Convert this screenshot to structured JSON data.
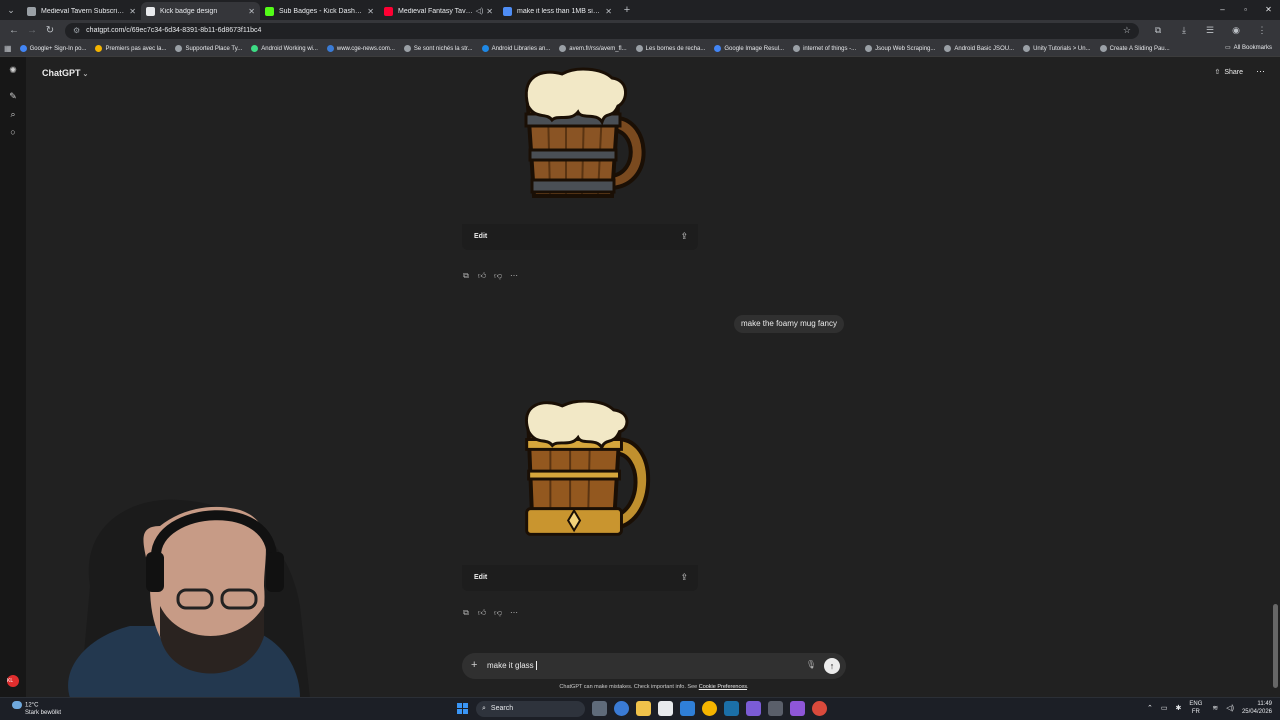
{
  "browser": {
    "tabs": [
      {
        "title": "Medieval Tavern Subscriber Ba...",
        "fav": "#9aa0a6",
        "active": false
      },
      {
        "title": "Kick badge design",
        "fav": "#e8eaed",
        "active": true
      },
      {
        "title": "Sub Badges - Kick Dashboard",
        "fav": "#53fc18",
        "active": false
      },
      {
        "title": "Medieval Fantasy Tavern 3",
        "fav": "#ff0033",
        "active": false
      },
      {
        "title": "make it less than 1MB size - Go...",
        "fav": "#4e8df5",
        "active": false
      }
    ],
    "url": "chatgpt.com/c/69ec7c34-6d34-8391-8b11-6d8673f11bc4",
    "bookmarks": [
      "Google+ Sign-In po...",
      "Premiers pas avec la...",
      "Supported Place Ty...",
      "Android Working wi...",
      "www.cge-news.com...",
      "Se sont nichés la str...",
      "Android Libraries an...",
      "avem.fr/rss/avem_fl...",
      "Les bornes de recha...",
      "Google Image Resul...",
      "internet of things -...",
      "Jsoup Web Scraping...",
      "Android Basic JSOU...",
      "Unity Tutorials > Un...",
      "Create A Sliding Pau..."
    ],
    "all_bookmarks": "All Bookmarks"
  },
  "chat": {
    "model": "ChatGPT",
    "share": "Share",
    "edit_label": "Edit",
    "user_message": "make the foamy mug fancy",
    "composer_text": "make it glass",
    "disclaimer": "ChatGPT can make mistakes. Check important info. See",
    "cookie_link": "Cookie Preferences",
    "kick_badge": "KL"
  },
  "taskbar": {
    "temp": "12°C",
    "weather": "Stark bewölkt",
    "search": "Search",
    "lang1": "ENG",
    "lang2": "FR",
    "time": "11:49",
    "date": "25/04/2026"
  },
  "icons": {
    "tab_menu": "chevron-down-icon",
    "new_chat": "pencil-square-icon",
    "search": "search-icon",
    "chats": "chat-bubble-icon",
    "copy": "copy-icon",
    "thumbs_up": "thumbs-up-icon",
    "thumbs_down": "thumbs-down-icon",
    "more": "more-dots-icon",
    "download": "share-upload-icon",
    "mic": "microphone-icon",
    "send": "arrow-up-icon"
  }
}
